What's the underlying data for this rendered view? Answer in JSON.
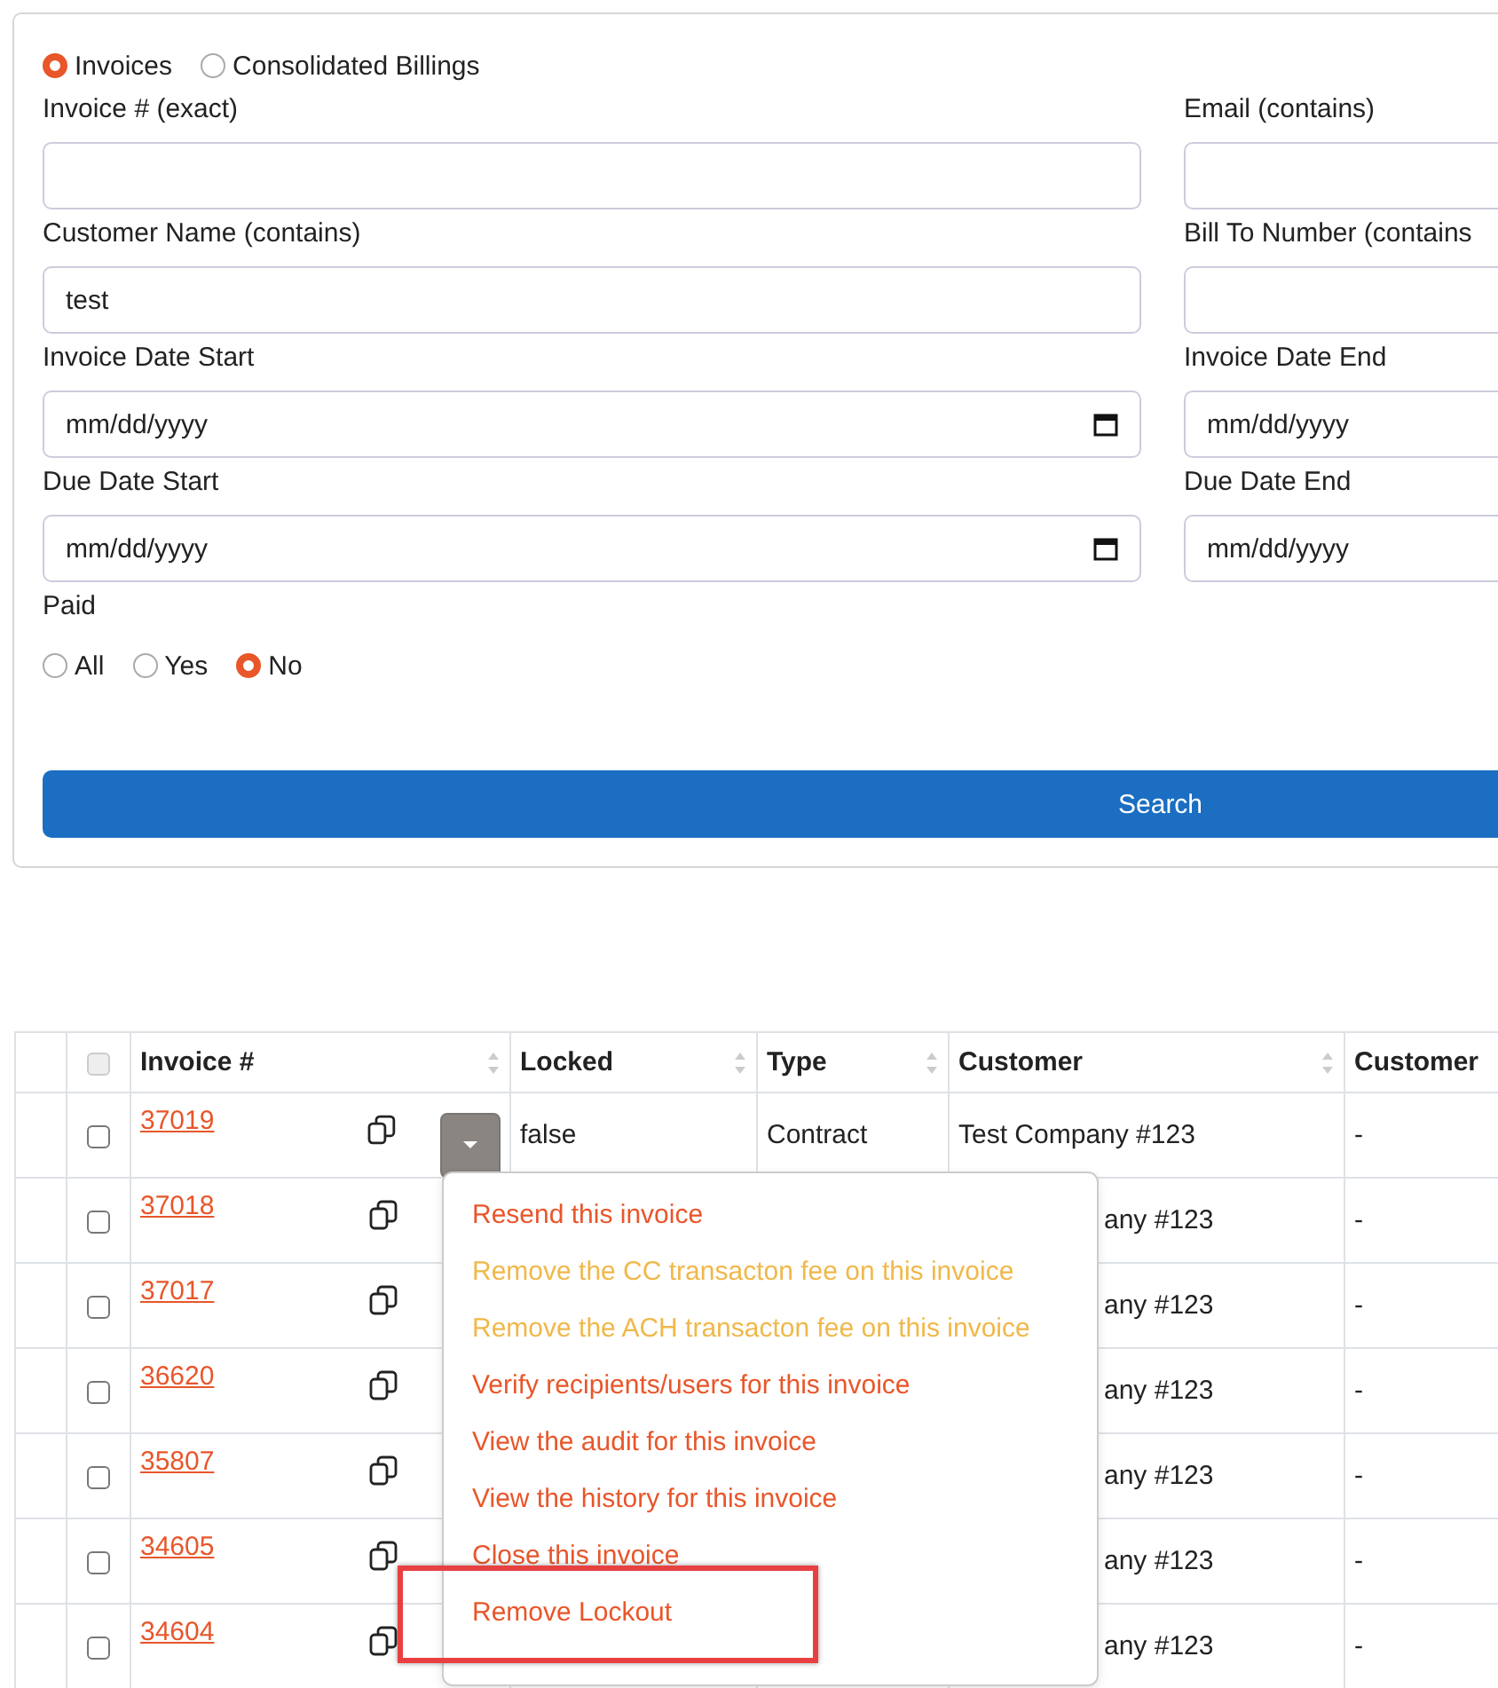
{
  "filter_form": {
    "mode_options": [
      {
        "label": "Invoices",
        "selected": true
      },
      {
        "label": "Consolidated Billings",
        "selected": false
      }
    ],
    "fields": [
      {
        "label": "Invoice # (exact)",
        "kind": "text"
      },
      {
        "label": "Email (contains)",
        "kind": "text"
      },
      {
        "label": "Customer Name (contains)",
        "kind": "text",
        "value": "test"
      },
      {
        "label": "Bill To Number (contains",
        "kind": "text"
      },
      {
        "label": "Invoice Date Start",
        "kind": "date",
        "placeholder": "mm/dd/yyyy"
      },
      {
        "label": "Invoice Date End",
        "kind": "date",
        "placeholder": "mm/dd/yyyy"
      },
      {
        "label": "Due Date Start",
        "kind": "date",
        "placeholder": "mm/dd/yyyy"
      },
      {
        "label": "Due Date End",
        "kind": "date",
        "placeholder": "mm/dd/yyyy"
      }
    ],
    "paid": {
      "label": "Paid",
      "options": [
        {
          "label": "All",
          "selected": false
        },
        {
          "label": "Yes",
          "selected": false
        },
        {
          "label": "No",
          "selected": true
        }
      ]
    },
    "search_button": "Search"
  },
  "table": {
    "select_all": {
      "checked": false,
      "disabled": true
    },
    "columns": [
      {
        "label": "Invoice #"
      },
      {
        "label": "Locked"
      },
      {
        "label": "Type"
      },
      {
        "label": "Customer"
      },
      {
        "label": "Customer"
      }
    ],
    "rows": [
      {
        "checked": false,
        "invoice": "37019",
        "menu_expanded": true,
        "locked": "false",
        "type": "Contract",
        "customer": "Test Company #123",
        "customer_number": "-"
      },
      {
        "checked": false,
        "invoice": "37018",
        "menu_expanded": false,
        "customer": "any #123",
        "customer_number": "-"
      },
      {
        "checked": false,
        "invoice": "37017",
        "menu_expanded": false,
        "customer": "any #123",
        "customer_number": "-"
      },
      {
        "checked": false,
        "invoice": "36620",
        "menu_expanded": false,
        "customer": "any #123",
        "customer_number": "-"
      },
      {
        "checked": false,
        "invoice": "35807",
        "menu_expanded": false,
        "customer": "any #123",
        "customer_number": "-"
      },
      {
        "checked": false,
        "invoice": "34605",
        "menu_expanded": false,
        "customer": "any #123",
        "customer_number": "-"
      },
      {
        "checked": false,
        "invoice": "34604",
        "menu_expanded": false,
        "customer": "any #123",
        "customer_number": "-"
      }
    ]
  },
  "action_menu": {
    "items": [
      {
        "label": "Resend this invoice",
        "disabled": false,
        "highlighted": false
      },
      {
        "label": "Remove the CC transacton fee on this invoice",
        "disabled": true,
        "highlighted": false
      },
      {
        "label": "Remove the ACH transacton fee on this invoice",
        "disabled": true,
        "highlighted": false
      },
      {
        "label": "Verify recipients/users for this invoice",
        "disabled": false,
        "highlighted": false
      },
      {
        "label": "View the audit for this invoice",
        "disabled": false,
        "highlighted": false
      },
      {
        "label": "View the history for this invoice",
        "disabled": false,
        "highlighted": false
      },
      {
        "label": "Close this invoice",
        "disabled": false,
        "highlighted": false
      },
      {
        "label": "Remove Lockout",
        "disabled": false,
        "highlighted": true
      }
    ]
  }
}
